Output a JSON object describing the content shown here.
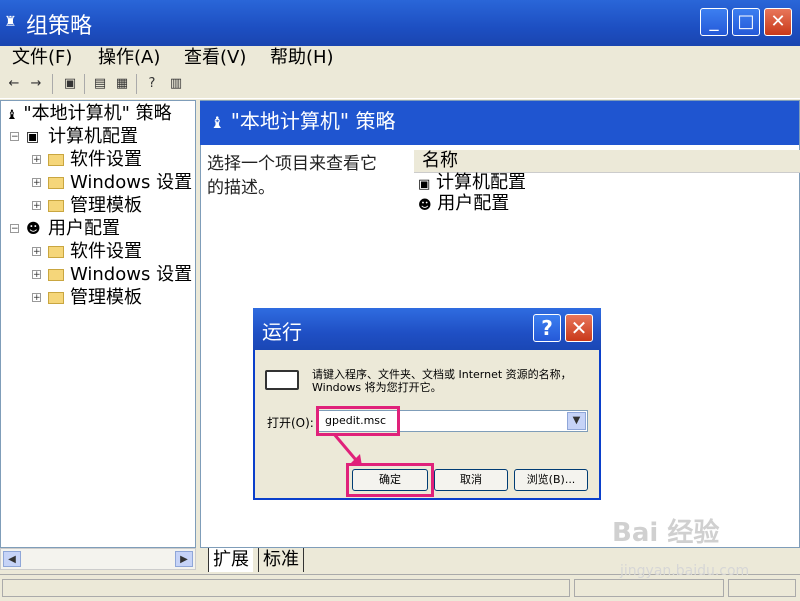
{
  "window": {
    "title": "组策略"
  },
  "menu": [
    "文件(F)",
    "操作(A)",
    "查看(V)",
    "帮助(H)"
  ],
  "tree": {
    "root": "\"本地计算机\" 策略",
    "computer": "计算机配置",
    "user": "用户配置",
    "children": [
      "软件设置",
      "Windows 设置",
      "管理模板"
    ]
  },
  "right_pane": {
    "header": "\"本地计算机\" 策略",
    "description_line1": "选择一个项目来查看它",
    "description_line2": "的描述。",
    "column_name": "名称",
    "items": [
      "计算机配置",
      "用户配置"
    ]
  },
  "tabs": [
    "扩展",
    "标准"
  ],
  "run_dialog": {
    "title": "运行",
    "message": "请键入程序、文件夹、文档或 Internet 资源的名称，Windows 将为您打开它。",
    "open_label": "打开(O):",
    "input_value": "gpedit.msc",
    "ok": "确定",
    "cancel": "取消",
    "browse": "浏览(B)..."
  },
  "watermark": {
    "brand": "Bai 经验",
    "url": "jingyan.baidu.com"
  },
  "colors": {
    "titlebar": "#1F55D0",
    "highlight": "#E0217A"
  }
}
